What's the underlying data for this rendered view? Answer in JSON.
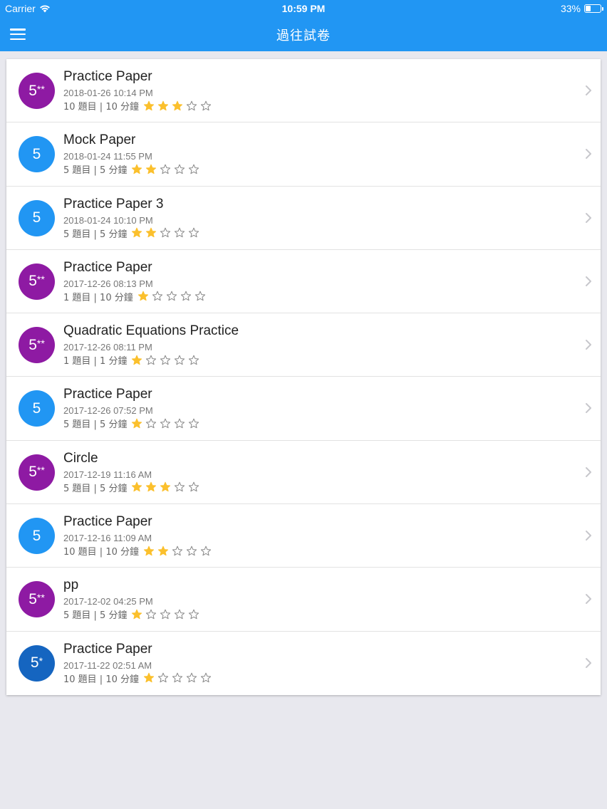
{
  "status_bar": {
    "carrier": "Carrier",
    "time": "10:59 PM",
    "battery": "33%",
    "battery_level": 0.33
  },
  "header": {
    "title": "過往試卷"
  },
  "colors": {
    "header": "#2196f3",
    "badge_5_star_star": "#8e1aa3",
    "badge_5": "#2196f3",
    "badge_5_star": "#1565c0",
    "star_filled": "#fbc02d",
    "star_empty": "#888888"
  },
  "papers": [
    {
      "grade": "5",
      "grade_suffix": "**",
      "title": "Practice Paper",
      "date": "2018-01-26 10:14 PM",
      "meta": "10 題目 | 10 分鐘",
      "rating": 3
    },
    {
      "grade": "5",
      "grade_suffix": "",
      "title": "Mock Paper",
      "date": "2018-01-24 11:55 PM",
      "meta": "5 題目 | 5 分鐘",
      "rating": 2
    },
    {
      "grade": "5",
      "grade_suffix": "",
      "title": "Practice Paper 3",
      "date": "2018-01-24 10:10 PM",
      "meta": "5 題目 | 5 分鐘",
      "rating": 2
    },
    {
      "grade": "5",
      "grade_suffix": "**",
      "title": "Practice Paper",
      "date": "2017-12-26 08:13 PM",
      "meta": "1 題目 | 10 分鐘",
      "rating": 1
    },
    {
      "grade": "5",
      "grade_suffix": "**",
      "title": "Quadratic Equations Practice",
      "date": "2017-12-26 08:11 PM",
      "meta": "1 題目 | 1 分鐘",
      "rating": 1
    },
    {
      "grade": "5",
      "grade_suffix": "",
      "title": "Practice Paper",
      "date": "2017-12-26 07:52 PM",
      "meta": "5 題目 | 5 分鐘",
      "rating": 1
    },
    {
      "grade": "5",
      "grade_suffix": "**",
      "title": "Circle",
      "date": "2017-12-19 11:16 AM",
      "meta": "5 題目 | 5 分鐘",
      "rating": 3
    },
    {
      "grade": "5",
      "grade_suffix": "",
      "title": "Practice Paper",
      "date": "2017-12-16 11:09 AM",
      "meta": "10 題目 | 10 分鐘",
      "rating": 2
    },
    {
      "grade": "5",
      "grade_suffix": "**",
      "title": "pp",
      "date": "2017-12-02 04:25 PM",
      "meta": "5 題目 | 5 分鐘",
      "rating": 1
    },
    {
      "grade": "5",
      "grade_suffix": "*",
      "title": "Practice Paper",
      "date": "2017-11-22 02:51 AM",
      "meta": "10 題目 | 10 分鐘",
      "rating": 1
    }
  ],
  "max_rating": 5
}
